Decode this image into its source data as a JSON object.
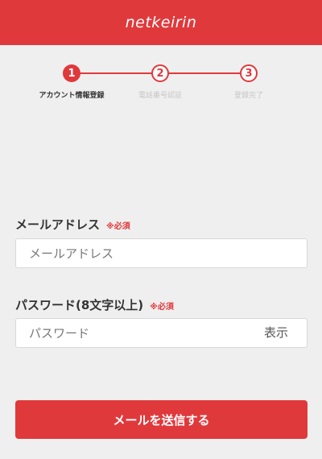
{
  "header": {
    "logo": "netkeirin"
  },
  "steps": [
    {
      "number": "1",
      "label": "アカウント情報登録"
    },
    {
      "number": "2",
      "label": "電話番号認証"
    },
    {
      "number": "3",
      "label": "登録完了"
    }
  ],
  "form": {
    "email": {
      "label": "メールアドレス",
      "required": "※必須",
      "placeholder": "メールアドレス",
      "value": ""
    },
    "password": {
      "label": "パスワード(8文字以上)",
      "required": "※必須",
      "placeholder": "パスワード",
      "value": "",
      "toggle": "表示"
    },
    "submit": "メールを送信する"
  },
  "colors": {
    "accent": "#e0393c",
    "background": "#efefef"
  }
}
